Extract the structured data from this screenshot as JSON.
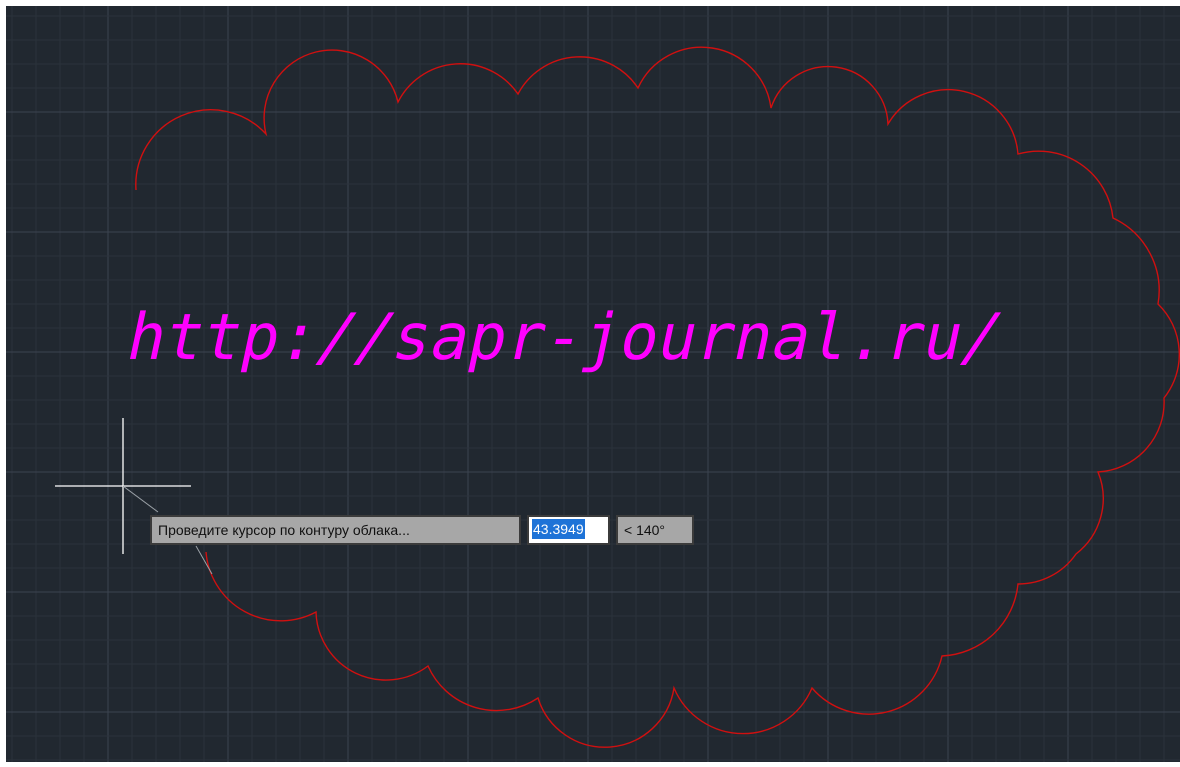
{
  "caption": "",
  "colors": {
    "background": "#212830",
    "grid_minor": "#2b323b",
    "grid_major": "#3c4450",
    "cloud_stroke": "#d01010",
    "text_magenta": "#ff00ff",
    "crosshair": "#ffffff"
  },
  "drawing": {
    "watermark_text": "http://sapr-journal.ru/"
  },
  "dynamic_input": {
    "prompt": "Проведите курсор по контуру облака...",
    "distance_value": "43.3949",
    "angle_value": "< 140°"
  }
}
